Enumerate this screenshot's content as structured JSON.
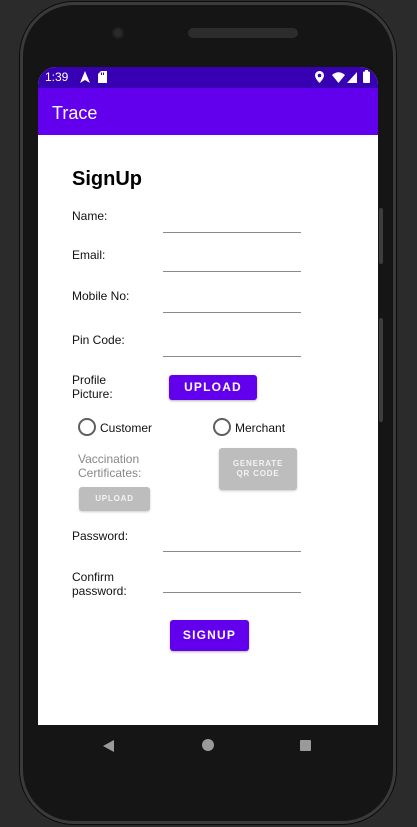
{
  "status_bar": {
    "time": "1:39",
    "left_icons": [
      "navigation-icon",
      "sd-card-icon"
    ],
    "right_icons": [
      "location-icon",
      "wifi-icon",
      "signal-icon",
      "battery-icon"
    ],
    "color": "#3700b3"
  },
  "app_bar": {
    "title": "Trace",
    "color": "#6200ee"
  },
  "form": {
    "heading": "SignUp",
    "name_label": "Name:",
    "email_label": "Email:",
    "mobile_label": "Mobile No:",
    "pincode_label": "Pin Code:",
    "profile_label_line1": "Profile",
    "profile_label_line2": "Picture:",
    "upload_label": "UPLOAD",
    "customer_label": "Customer",
    "merchant_label": "Merchant",
    "vaccination_label_line1": "Vaccination",
    "vaccination_label_line2": "Certificates:",
    "vaccination_upload_label": "UPLOAD",
    "generate_line1": "GENERATE",
    "generate_line2": "QR CODE",
    "password_label": "Password:",
    "confirm_line1": "Confirm",
    "confirm_line2": "password:",
    "signup_label": "SIGNUP"
  },
  "nav_bar": {
    "icons": [
      "back-icon",
      "home-icon",
      "recents-icon"
    ]
  }
}
